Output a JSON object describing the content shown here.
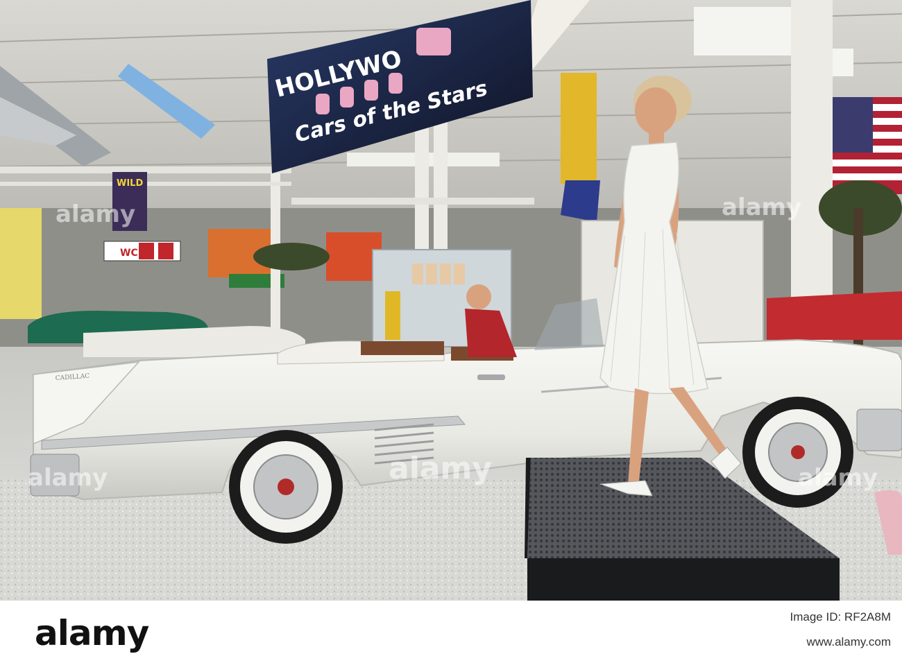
{
  "banner": {
    "line1": "HOLLYWO",
    "line2": "Cars of the Stars"
  },
  "signs": {
    "wc": "WC",
    "wild": "WILD",
    "car_badge": "CADILLAC"
  },
  "watermark": {
    "text": "alamy"
  },
  "footer": {
    "logo": "alamy",
    "image_id": "Image ID: RF2A8M",
    "url": "www.alamy.com"
  },
  "colors": {
    "car_body": "#efefea",
    "dress": "#f3f3ef",
    "banner_bg": "#1b2236",
    "platform": "#3a3b3f"
  }
}
